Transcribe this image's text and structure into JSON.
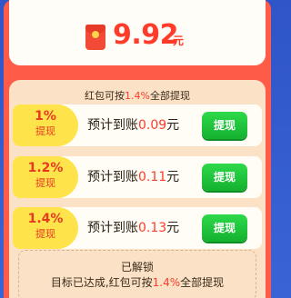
{
  "balance": {
    "amount": "9.92",
    "unit": "元"
  },
  "info": {
    "prefix": "红包可按",
    "pct": "1.4%",
    "suffix": "全部提现"
  },
  "tiers": [
    {
      "pct": "1%",
      "tag_label": "提现",
      "text": "预计到账",
      "value": "0.09",
      "unit": "元",
      "button": "提现"
    },
    {
      "pct": "1.2%",
      "tag_label": "提现",
      "text": "预计到账",
      "value": "0.11",
      "unit": "元",
      "button": "提现"
    },
    {
      "pct": "1.4%",
      "tag_label": "提现",
      "text": "预计到账",
      "value": "0.13",
      "unit": "元",
      "button": "提现"
    }
  ],
  "unlock": {
    "title": "已解锁",
    "desc_prefix": "目标已达成,红包可按",
    "desc_pct": "1.4%",
    "desc_suffix": "全部提现"
  }
}
